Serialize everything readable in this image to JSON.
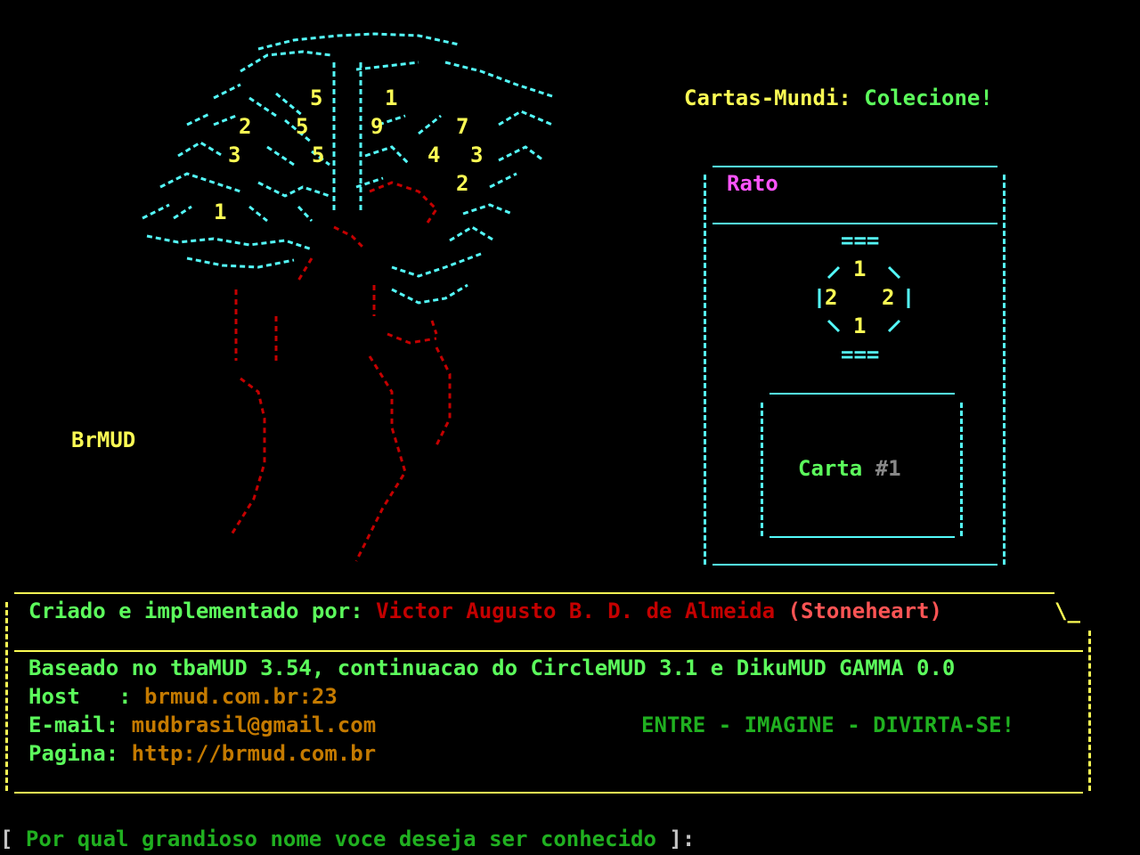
{
  "colors": {
    "background": "#000000",
    "green": "#5cfc5c",
    "dark_green": "#20b020",
    "yellow": "#fcfc54",
    "cyan": "#54fcfc",
    "magenta": "#fc54fc",
    "red": "#c40000",
    "light_red": "#fc5454",
    "orange": "#c47a00"
  },
  "art": {
    "brand": "BrMUD",
    "numbers": [
      "5",
      "1",
      "2",
      "5",
      "9",
      "7",
      "3",
      "5",
      "4",
      "3",
      "2",
      "1"
    ]
  },
  "header": {
    "label": "Cartas-Mundi:",
    "tagline": "Colecione!"
  },
  "card": {
    "name": "Rato",
    "top": "===",
    "bottom": "===",
    "stat_top": "1",
    "stat_left": "2",
    "stat_right": "2",
    "stat_bottom": "1",
    "inner_label": "Carta",
    "inner_number": "#1"
  },
  "info": {
    "credit_label": "Criado e implementado por:",
    "author_name": "Victor Augusto B. D. de Almeida",
    "author_nick": "(Stoneheart)",
    "based_on": "Baseado no tbaMUD 3.54, continuacao do CircleMUD 3.1 e DikuMUD GAMMA 0.0",
    "host_label": "Host   :",
    "host_value": "brmud.com.br:23",
    "email_label": "E-mail:",
    "email_value": "mudbrasil@gmail.com",
    "slogan": "ENTRE - IMAGINE - DIVIRTA-SE!",
    "page_label": "Pagina:",
    "page_value": "http://brmud.com.br"
  },
  "prompt": {
    "open_bracket": "[",
    "text": "Por qual grandioso nome voce deseja ser conhecido",
    "close_bracket": "]:",
    "input_value": ""
  }
}
